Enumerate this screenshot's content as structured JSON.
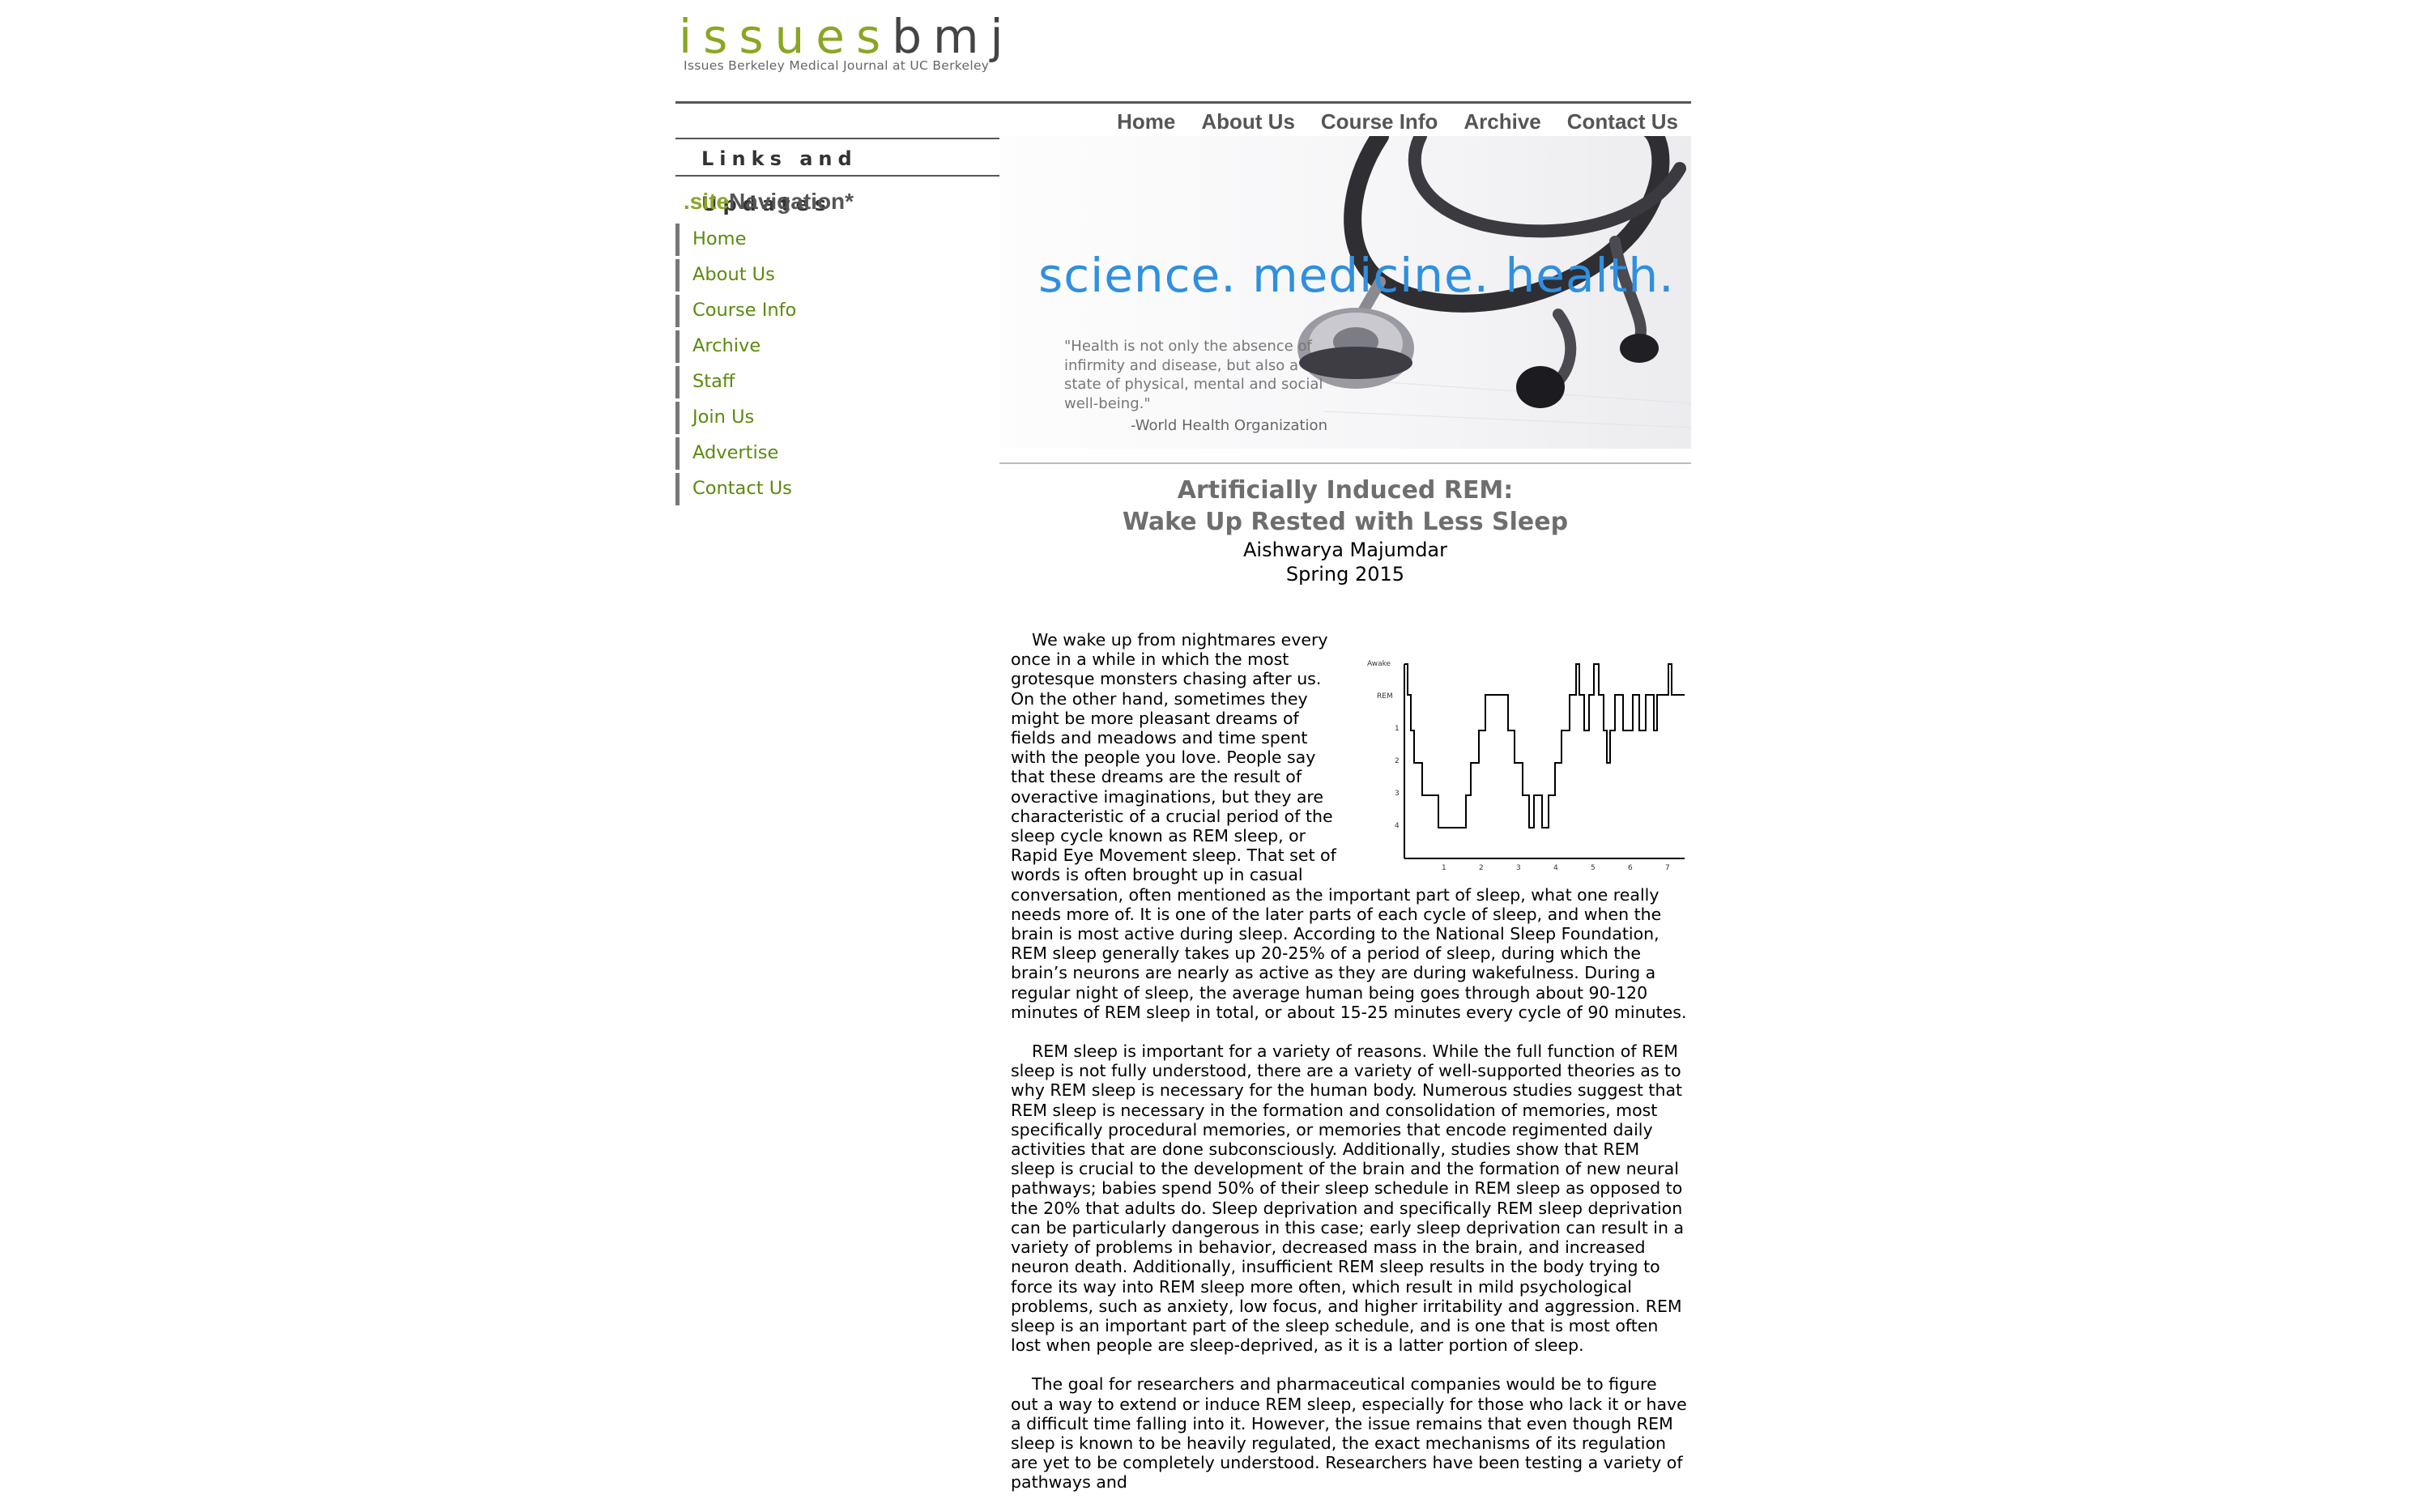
{
  "logo": {
    "word_green": "issues",
    "word_dark": "bmj",
    "tagline": "Issues Berkeley Medical Journal at UC Berkeley"
  },
  "topnav": [
    "Home",
    "About Us",
    "Course Info",
    "Archive",
    "Contact Us"
  ],
  "sidebar": {
    "heading": "Links and Updates",
    "sitenav_green": ".site",
    "sitenav_dark": "Navigation*",
    "items": [
      "Home",
      "About Us",
      "Course Info",
      "Archive",
      "Staff",
      "Join Us",
      "Advertise",
      "Contact Us"
    ]
  },
  "banner": {
    "slogan": "science. medicine. health.",
    "quote": "\"Health is not only the absence of infirmity and disease, but also a state of physical, mental and social well-being.\"",
    "source": "-World Health Organization"
  },
  "article": {
    "title_line1": "Artificially Induced REM:",
    "title_line2": "Wake Up Rested with Less Sleep",
    "author": "Aishwarya Majumdar",
    "date": "Spring 2015",
    "paragraphs": [
      "We wake up from nightmares every once in a while in which the most grotesque monsters chasing after us. On the other hand, sometimes they might be more pleasant dreams of fields and meadows and time spent with the people you love. People say that these dreams are the result of overactive imaginations, but they are characteristic of a crucial period of the sleep cycle known as REM sleep, or Rapid Eye Movement sleep. That set of words is often brought up in casual conversation, often mentioned as the important part of sleep, what one really needs more of. It is one of the later parts of each cycle of sleep, and when the brain is most active during sleep. According to the National Sleep Foundation, REM sleep generally takes up 20-25% of a period of sleep, during which the brain’s neurons are nearly as active as they are during wakefulness. During a regular night of sleep, the average human being goes through about 90-120 minutes of REM sleep in total, or about 15-25 minutes every cycle of 90 minutes.",
      "REM sleep is important for a variety of reasons. While the full function of REM sleep is not fully understood, there are a variety of well-supported theories as to why REM sleep is necessary for the human body. Numerous studies suggest that REM sleep is necessary in the formation and consolidation of memories, most specifically procedural memories, or memories that encode regimented daily activities that are done subconsciously. Additionally, studies show that REM sleep is crucial to the development of the brain and the formation of new neural pathways; babies spend 50% of their sleep schedule in REM sleep as opposed to the 20% that adults do. Sleep deprivation and specifically REM sleep deprivation can be particularly dangerous in this case; early sleep deprivation can result in a variety of problems in behavior, decreased mass in the brain, and increased neuron death. Additionally, insufficient REM sleep results in the body trying to force its way into REM sleep more often, which result in mild psychological problems, such as anxiety, low focus, and higher irritability and aggression. REM sleep is an important part of the sleep schedule, and is one that is most often lost when people are sleep-deprived, as it is a latter portion of sleep.",
      "The goal for researchers and pharmaceutical companies would be to figure out a way to extend or induce REM sleep, especially for those who lack it or have a difficult time falling into it. However, the issue remains that even though REM sleep is known to be heavily regulated, the exact mechanisms of its regulation are yet to be completely understood. Researchers have been testing a variety of pathways and"
    ]
  },
  "hypnogram": {
    "ylabels": [
      "Awake",
      "REM",
      "1",
      "2",
      "3",
      "4"
    ],
    "xlabels": [
      "1",
      "2",
      "3",
      "4",
      "5",
      "6",
      "7"
    ]
  },
  "colors": {
    "brand_green": "#8aa623",
    "link_green": "#5b8a0e",
    "slogan_blue": "#2f8fe0",
    "nav_grey": "#555555"
  }
}
